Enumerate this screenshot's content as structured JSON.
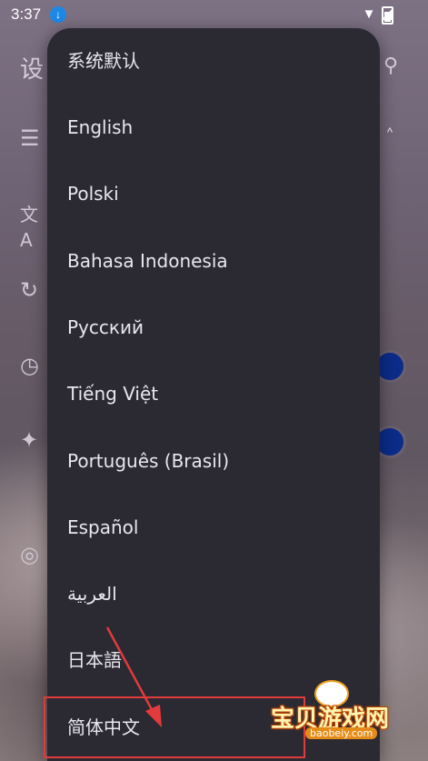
{
  "status_bar": {
    "time": "3:37"
  },
  "background": {
    "title_char": "设"
  },
  "language_menu": {
    "items": [
      {
        "label": "系统默认"
      },
      {
        "label": "English"
      },
      {
        "label": "Polski"
      },
      {
        "label": "Bahasa Indonesia"
      },
      {
        "label": "Русский"
      },
      {
        "label": "Tiếng Việt"
      },
      {
        "label": "Português (Brasil)"
      },
      {
        "label": "Español"
      },
      {
        "label": "العربية"
      },
      {
        "label": "日本語"
      },
      {
        "label": "简体中文"
      }
    ]
  },
  "watermark": {
    "text": "宝贝游戏网",
    "url": "baobeiy.com"
  },
  "colors": {
    "menu_bg": "#2b2a33",
    "menu_text": "#e9e6ee",
    "annotation_red": "#e23b3b",
    "toggle_blue": "#0b2c8a"
  }
}
